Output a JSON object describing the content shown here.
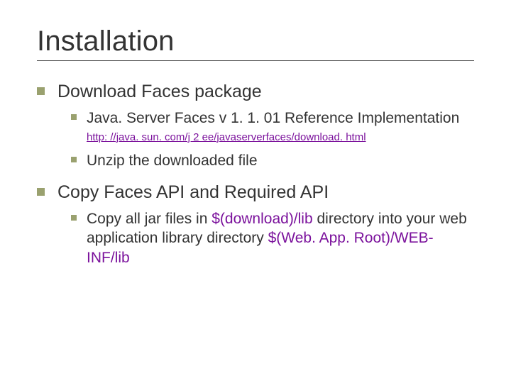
{
  "title": "Installation",
  "b1": {
    "text": "Download Faces package",
    "s1": "Java. Server Faces v 1. 1. 01 Reference Implementation",
    "url": "http: //java. sun. com/j 2 ee/javaserverfaces/download. html",
    "s2": "Unzip the downloaded file"
  },
  "b2": {
    "text": "Copy Faces API and Required API",
    "s1_pre": "Copy all jar files in ",
    "s1_path1": "$(download)/lib",
    "s1_mid": " directory into your web application library directory ",
    "s1_path2": "$(Web. App. Root)/WEB-INF/lib"
  },
  "colors": {
    "bullet": "#9aa16f",
    "link": "#7b129c"
  }
}
